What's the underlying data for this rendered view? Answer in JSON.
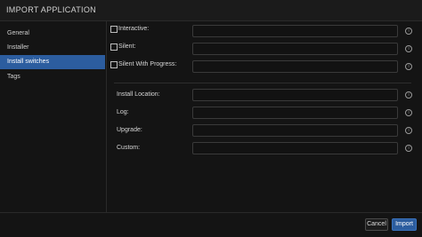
{
  "window": {
    "title": "IMPORT APPLICATION"
  },
  "sidebar": {
    "items": [
      {
        "label": "General",
        "active": false
      },
      {
        "label": "Installer",
        "active": false
      },
      {
        "label": "Install switches",
        "active": true
      },
      {
        "label": "Tags",
        "active": false
      }
    ]
  },
  "switches": [
    {
      "label": "Interactive:",
      "checked": false,
      "value": ""
    },
    {
      "label": "Silent:",
      "checked": false,
      "value": ""
    },
    {
      "label": "Silent With Progress:",
      "checked": false,
      "value": ""
    }
  ],
  "fields": [
    {
      "label": "Install Location:",
      "value": ""
    },
    {
      "label": "Log:",
      "value": ""
    },
    {
      "label": "Upgrade:",
      "value": ""
    },
    {
      "label": "Custom:",
      "value": ""
    }
  ],
  "footer": {
    "cancel_label": "Cancel",
    "import_label": "Import"
  },
  "colors": {
    "accent": "#2c5d9f",
    "background": "#141414"
  }
}
